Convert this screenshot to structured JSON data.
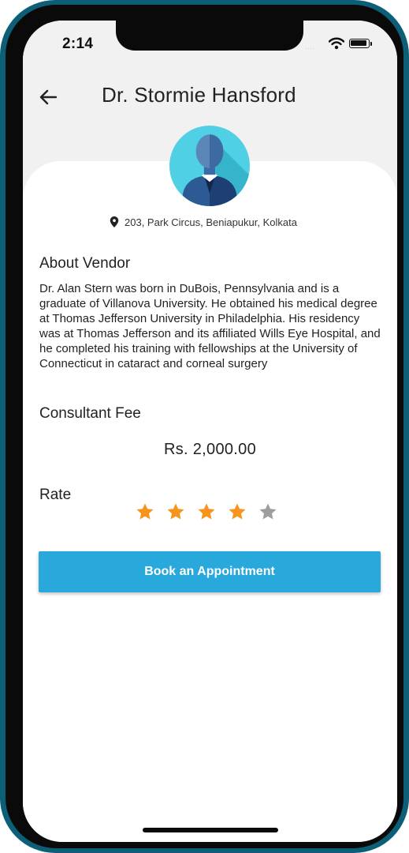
{
  "status_bar": {
    "time": "2:14",
    "signal": "....",
    "wifi_icon": "wifi-icon",
    "battery_icon": "battery-icon"
  },
  "header": {
    "back_icon": "arrow-left-icon",
    "title": "Dr. Stormie Hansford"
  },
  "profile": {
    "avatar_icon": "doctor-avatar-icon",
    "location_icon": "map-pin-icon",
    "address": "203, Park Circus, Beniapukur, Kolkata"
  },
  "about": {
    "heading": "About Vendor",
    "text": "Dr. Alan Stern was born in DuBois, Pennsylvania and is a graduate of Villanova University. He obtained his medical degree at Thomas Jefferson University in Philadelphia. His residency was at Thomas Jefferson and its affiliated Wills Eye Hospital, and he completed his training with fellowships at the University of    Connecticut    in cataract and corneal surgery"
  },
  "fee": {
    "heading": "Consultant Fee",
    "value": "Rs. 2,000.00"
  },
  "rating": {
    "heading": "Rate",
    "value": 4,
    "max": 5,
    "filled_color": "#f7941d",
    "empty_color": "#9e9e9e"
  },
  "actions": {
    "book_label": "Book an Appointment",
    "button_color": "#29a8dc"
  }
}
